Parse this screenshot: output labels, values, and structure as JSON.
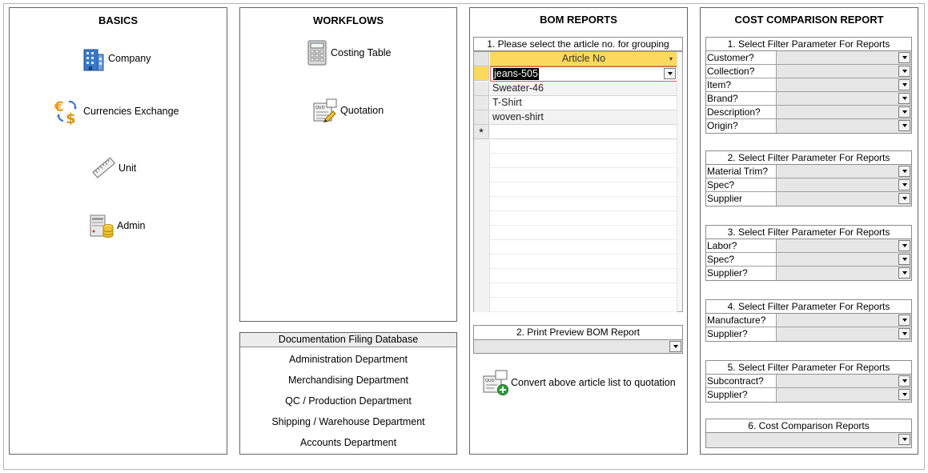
{
  "basics": {
    "title": "BASICS",
    "items": [
      {
        "label": "Company",
        "icon": "building-icon"
      },
      {
        "label": "Currencies Exchange",
        "icon": "currency-exchange-icon"
      },
      {
        "label": "Unit",
        "icon": "ruler-icon"
      },
      {
        "label": "Admin",
        "icon": "admin-database-icon"
      }
    ]
  },
  "workflows": {
    "title": "WORKFLOWS",
    "items": [
      {
        "label": "Costing Table",
        "icon": "calculator-icon"
      },
      {
        "label": "Quotation",
        "icon": "quotation-icon"
      }
    ]
  },
  "documentation": {
    "title": "Documentation Filing Database",
    "items": [
      "Administration Department",
      "Merchandising Department",
      "QC / Production Department",
      "Shipping / Warehouse Department",
      "Accounts Department"
    ]
  },
  "bom": {
    "title": "BOM REPORTS",
    "select_label": "1. Please select the article no. for grouping",
    "column_header": "Article No",
    "current_value": "jeans-505",
    "articles": [
      "Sweater-46",
      "T-Shirt",
      "woven-shirt"
    ],
    "new_row_marker": "*",
    "print_label": "2. Print Preview BOM Report",
    "print_value": "",
    "convert_label": "Convert above article list to quotation",
    "colors": {
      "header_bg": "#fbd95c",
      "current_border": "#e06060"
    }
  },
  "cost": {
    "title": "COST COMPARISON REPORT",
    "groups": [
      {
        "heading": "1. Select Filter Parameter For Reports",
        "fields": [
          "Customer?",
          "Collection?",
          "Item?",
          "Brand?",
          "Description?",
          "Origin?"
        ]
      },
      {
        "heading": "2. Select Filter Parameter For Reports",
        "fields": [
          "Material Trim?",
          "Spec?",
          "Supplier"
        ]
      },
      {
        "heading": "3. Select Filter Parameter For Reports",
        "fields": [
          "Labor?",
          "Spec?",
          "Supplier?"
        ]
      },
      {
        "heading": "4. Select Filter Parameter For Reports",
        "fields": [
          "Manufacture?",
          "Supplier?"
        ]
      },
      {
        "heading": "5. Select Filter Parameter For Reports",
        "fields": [
          "Subcontract?",
          "Supplier?"
        ]
      }
    ],
    "final_label": "6. Cost Comparison Reports",
    "final_value": ""
  }
}
